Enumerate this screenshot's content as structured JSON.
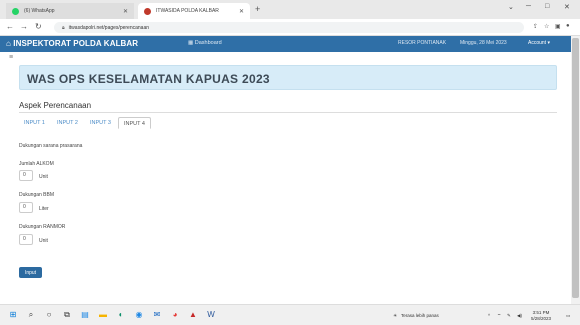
{
  "browser": {
    "tabs": [
      {
        "title": "(6) WhatsApp",
        "fav_color": "#25d366"
      },
      {
        "title": "ITWASIDA POLDA KALBAR",
        "fav_color": "#c0392b"
      }
    ],
    "new_tab": "+",
    "window_controls": [
      "⌄",
      "─",
      "□",
      "✕"
    ],
    "url": "itwasdapolri.net/pages/perencanaan"
  },
  "navbar": {
    "brand": "INSPEKTORAT POLDA KALBAR",
    "dashboard": "Dashboard",
    "location": "RESOR PONTIANAK",
    "datetime": "Minggu, 28 Mei 2023",
    "account": "Account ▾"
  },
  "page": {
    "title": "WAS OPS KESELAMATAN KAPUAS 2023",
    "section": "Aspek Perencanaan",
    "tabs": [
      "INPUT 1",
      "INPUT 2",
      "INPUT 3",
      "INPUT 4"
    ],
    "active_tab": "INPUT 4",
    "subheading": "Dukungan sarana prasarana",
    "fields": [
      {
        "label": "Jumlah ALKOM",
        "value": "0",
        "unit": "Unit"
      },
      {
        "label": "Dukungan BBM",
        "value": "0",
        "unit": "Liter"
      },
      {
        "label": "Dukungan RANMOR",
        "value": "0",
        "unit": "Unit"
      }
    ],
    "submit": "Input"
  },
  "taskbar": {
    "tray_text": "Terasa lebih panas",
    "time": "3:51 PM",
    "date": "5/28/2023"
  }
}
